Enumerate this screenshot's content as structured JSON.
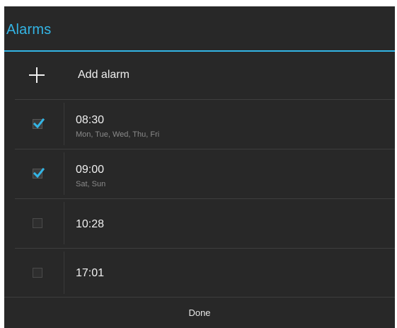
{
  "dialog": {
    "title": "Alarms"
  },
  "add_alarm": {
    "label": "Add alarm",
    "icon": "plus-icon"
  },
  "alarms": [
    {
      "time": "08:30",
      "days": "Mon, Tue, Wed, Thu, Fri",
      "enabled": true
    },
    {
      "time": "09:00",
      "days": "Sat, Sun",
      "enabled": true
    },
    {
      "time": "10:28",
      "days": "",
      "enabled": false
    },
    {
      "time": "17:01",
      "days": "",
      "enabled": false
    }
  ],
  "footer": {
    "done_label": "Done"
  },
  "colors": {
    "accent": "#33b5e5",
    "background": "#282828",
    "primary_text": "#f0f0f0",
    "secondary_text": "#8a8a8a"
  }
}
